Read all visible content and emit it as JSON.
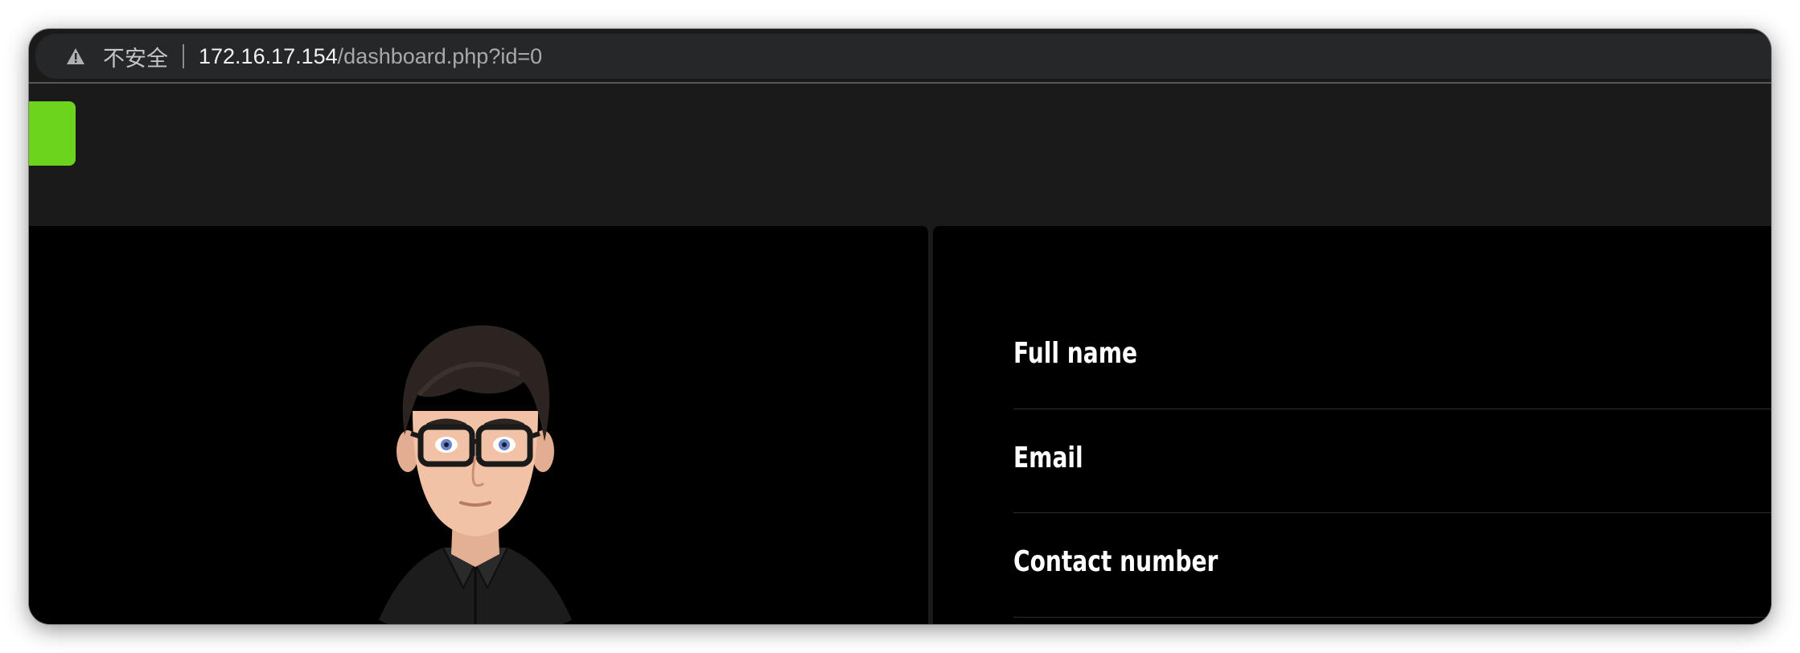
{
  "browser": {
    "insecure_label": "不安全",
    "url_host": "172.16.17.154",
    "url_path": "/dashboard.php?id=0",
    "warning_icon": "warning-triangle-icon"
  },
  "profile": {
    "fields": [
      {
        "label": "Full name"
      },
      {
        "label": "Email"
      },
      {
        "label": "Contact number"
      }
    ]
  },
  "colors": {
    "accent": "#6dd41e",
    "background": "#1a1a1a",
    "panel": "#000000"
  }
}
